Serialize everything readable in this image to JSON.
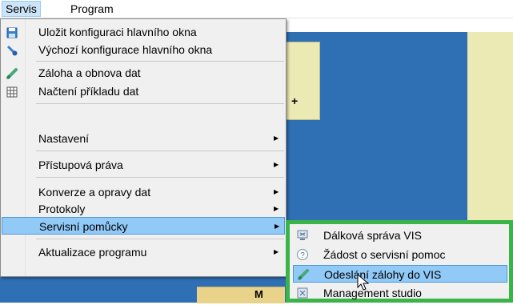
{
  "menubar": {
    "items": [
      {
        "label": "Servis"
      },
      {
        "label": "Program"
      }
    ]
  },
  "menu": {
    "items": [
      {
        "label": "Uložit konfiguraci hlavního okna",
        "icon": "save-icon"
      },
      {
        "label": "Výchozí konfigurace hlavního okna",
        "icon": "brush-icon"
      },
      {
        "label": "Záloha a obnova dat",
        "icon": "backup-icon"
      },
      {
        "label": "Načtení příkladu dat",
        "icon": "table-icon"
      },
      {
        "label": "Nastavení",
        "has_submenu": true
      },
      {
        "label": "Přístupová práva",
        "has_submenu": true
      },
      {
        "label": "Konverze a opravy dat",
        "has_submenu": true
      },
      {
        "label": "Protokoly",
        "has_submenu": true
      },
      {
        "label": "Servisní pomůcky",
        "has_submenu": true,
        "active": true
      },
      {
        "label": "Aktualizace programu",
        "has_submenu": true
      }
    ]
  },
  "submenu": {
    "items": [
      {
        "label": "Dálková správa VIS",
        "icon": "remote-icon"
      },
      {
        "label": "Žádost o servisní pomoc",
        "icon": "help-icon"
      },
      {
        "label": "Odeslání zálohy do VIS",
        "icon": "send-backup-icon",
        "active": true
      },
      {
        "label": "Management studio",
        "icon": "studio-icon"
      }
    ]
  },
  "background": {
    "plus": "+",
    "bottom_text": "M"
  },
  "colors": {
    "highlight": "#91c9f7",
    "submenu_border": "#3ab449",
    "app_background": "#2f6fb4"
  }
}
